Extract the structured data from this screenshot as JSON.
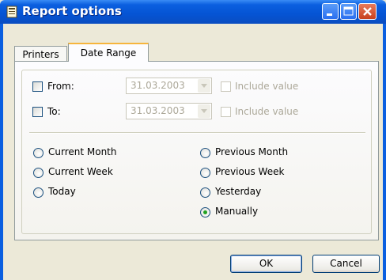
{
  "window": {
    "title": "Report options"
  },
  "tabs": [
    {
      "label": "Printers",
      "active": false
    },
    {
      "label": "Date Range",
      "active": true
    }
  ],
  "date_fields": {
    "from": {
      "label": "From:",
      "checked": false,
      "value": "31.03.2003",
      "include_label": "Include value",
      "include_checked": false,
      "enabled": false
    },
    "to": {
      "label": "To:",
      "checked": false,
      "value": "31.03.2003",
      "include_label": "Include value",
      "include_checked": false,
      "enabled": false
    }
  },
  "ranges": [
    {
      "label": "Current Month",
      "selected": false
    },
    {
      "label": "Current Week",
      "selected": false
    },
    {
      "label": "Today",
      "selected": false
    },
    {
      "label": "Previous Month",
      "selected": false
    },
    {
      "label": "Previous Week",
      "selected": false
    },
    {
      "label": "Yesterday",
      "selected": false
    },
    {
      "label": "Manually",
      "selected": true
    }
  ],
  "buttons": {
    "ok": "OK",
    "cancel": "Cancel"
  },
  "colors": {
    "titlebar": "#0554d4",
    "dialog_bg": "#ece9d8",
    "tab_highlight": "#f6b53c",
    "radio_dot": "#21a121"
  }
}
